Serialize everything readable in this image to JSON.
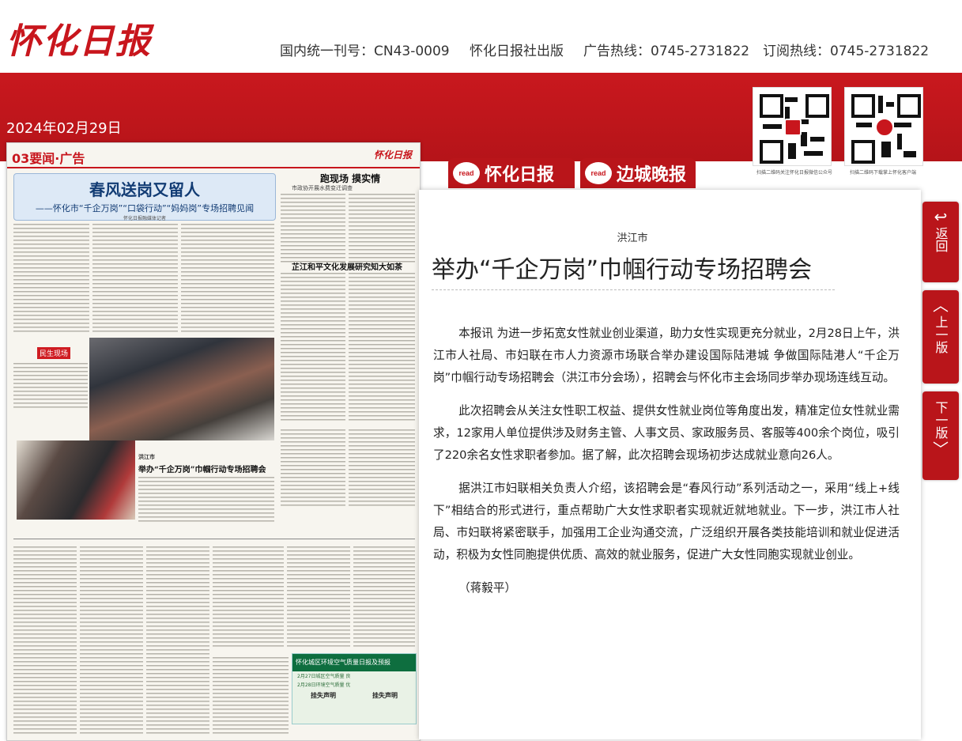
{
  "brand": {
    "logo": "怀化日报"
  },
  "topbar": {
    "issn": "国内统一刊号：CN43-0009",
    "publisher": "怀化日报社出版",
    "ad_hotline": "广告热线：0745-2731822",
    "sub_hotline": "订阅热线：0745-2731822"
  },
  "date": "2024年02月29日",
  "qr": [
    {
      "caption": "扫描二维码关注怀化日报微信公众号"
    },
    {
      "caption": "扫描二维码下载掌上怀化客户端"
    }
  ],
  "tabs": [
    {
      "read": "read",
      "label": "怀化日报",
      "active": true
    },
    {
      "read": "read",
      "label": "边城晚报",
      "active": false
    }
  ],
  "page": {
    "section": "03要闻·广告",
    "masthead": "怀化日报",
    "lead_title": "春风送岗又留人",
    "lead_subtitle": "——怀化市“千企万岗”“口袋行动”“妈妈岗”专场招聘见闻",
    "lead_byline": "怀化日报融媒体记者",
    "col_badge": "民生现场",
    "story2_title": "跑现场 摸实情",
    "story2_sub": "市政协开展水费变迁调查",
    "story3_title": "芷江和平文化发展研究知大如茶",
    "story4_kicker": "洪江市",
    "story4_title": "举办“千企万岗”巾帼行动专场招聘会",
    "banner_title": "怀化城区环境空气质量日报及预报",
    "banner_line1": "2月27日城区空气质量 良",
    "banner_line2": "2月28日环境空气质量 优",
    "notice_a": "挂失声明",
    "notice_b": "挂失声明"
  },
  "article": {
    "kicker": "洪江市",
    "title": "举办“千企万岗”巾帼行动专场招聘会",
    "paragraphs": [
      "本报讯 为进一步拓宽女性就业创业渠道，助力女性实现更充分就业，2月28日上午，洪江市人社局、市妇联在市人力资源市场联合举办建设国际陆港城 争做国际陆港人“千企万岗”巾帼行动专场招聘会（洪江市分会场），招聘会与怀化市主会场同步举办现场连线互动。",
      "此次招聘会从关注女性职工权益、提供女性就业岗位等角度出发，精准定位女性就业需求，12家用人单位提供涉及财务主管、人事文员、家政服务员、客服等400余个岗位，吸引了220余名女性求职者参加。据了解，此次招聘会现场初步达成就业意向26人。",
      "据洪江市妇联相关负责人介绍，该招聘会是“春风行动”系列活动之一，采用“线上+线下”相结合的形式进行，重点帮助广大女性求职者实现就近就地就业。下一步，洪江市人社局、市妇联将紧密联手，加强用工企业沟通交流，广泛组织开展各类技能培训和就业促进活动，积极为女性同胞提供优质、高效的就业服务，促进广大女性同胞实现就业创业。"
    ],
    "author": "（蒋毅平）"
  },
  "side_nav": [
    {
      "icon": "↩",
      "label": "返回"
    },
    {
      "icon": "︿",
      "label": "上一版"
    },
    {
      "icon": "﹀",
      "label": "下一版"
    }
  ]
}
